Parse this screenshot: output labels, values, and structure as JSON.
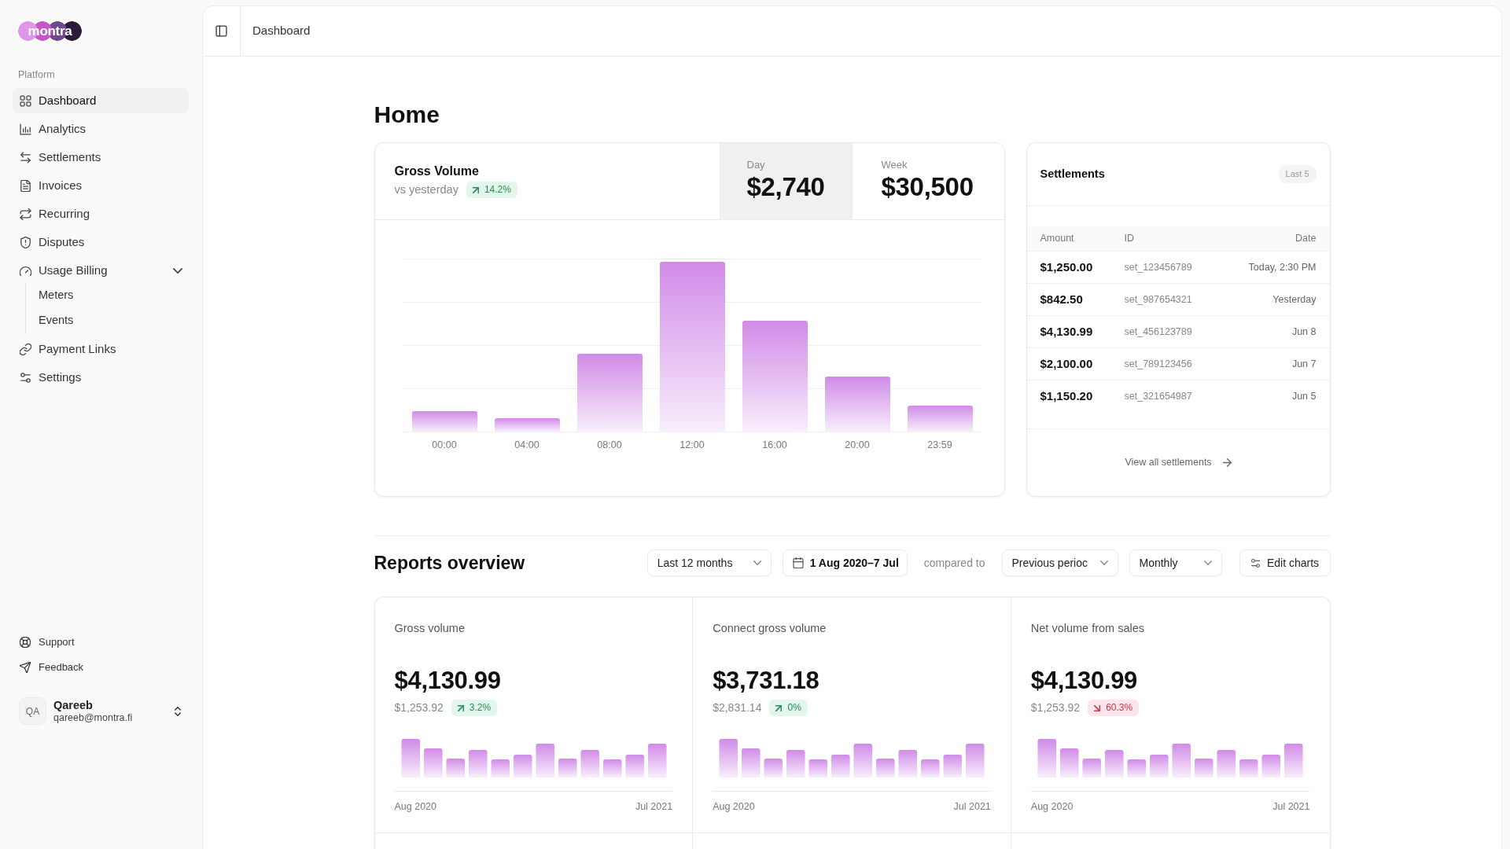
{
  "sidebar": {
    "logo": "montra",
    "section_label": "Platform",
    "items": [
      {
        "label": "Dashboard",
        "selected": true
      },
      {
        "label": "Analytics",
        "selected": false
      },
      {
        "label": "Settlements",
        "selected": false
      },
      {
        "label": "Invoices",
        "selected": false
      },
      {
        "label": "Recurring",
        "selected": false
      },
      {
        "label": "Disputes",
        "selected": false
      },
      {
        "label": "Usage Billing",
        "selected": false,
        "expanded": true,
        "children": [
          {
            "label": "Meters",
            "selected": false
          },
          {
            "label": "Events",
            "selected": false
          }
        ]
      },
      {
        "label": "Payment Links",
        "selected": false
      },
      {
        "label": "Settings",
        "selected": false
      }
    ],
    "footer_items": [
      {
        "label": "Support"
      },
      {
        "label": "Feedback"
      }
    ],
    "user": {
      "initials": "QA",
      "name": "Qareeb",
      "email": "qareeb@montra.fi"
    }
  },
  "header": {
    "breadcrumb": "Dashboard"
  },
  "page_title": "Home",
  "gross_volume": {
    "title": "Gross Volume",
    "subtitle": "vs yesterday",
    "change": {
      "value": "14.2%",
      "kind": "up"
    },
    "stats": [
      {
        "label": "Day",
        "value": "$2,740",
        "selected": true
      },
      {
        "label": "Week",
        "value": "$30,500",
        "selected": false
      }
    ],
    "axis_labels": [
      "00:00",
      "04:00",
      "08:00",
      "12:00",
      "16:00",
      "20:00",
      "23:59"
    ]
  },
  "settlements": {
    "title": "Settlements",
    "badge": "Last 5",
    "columns": [
      "Amount",
      "ID",
      "Date"
    ],
    "rows": [
      {
        "amount": "$1,250.00",
        "id": "set_123456789",
        "date": "Today, 2:30 PM"
      },
      {
        "amount": "$842.50",
        "id": "set_987654321",
        "date": "Yesterday"
      },
      {
        "amount": "$4,130.99",
        "id": "set_456123789",
        "date": "Jun 8"
      },
      {
        "amount": "$2,100.00",
        "id": "set_789123456",
        "date": "Jun 7"
      },
      {
        "amount": "$1,150.20",
        "id": "set_321654987",
        "date": "Jun 5"
      }
    ],
    "footer_link": "View all settlements"
  },
  "reports": {
    "title": "Reports overview",
    "filters": [
      {
        "kind": "dropdown",
        "label": "Last 12 months"
      },
      {
        "kind": "date",
        "label": "1 Aug 2020–7 Jul"
      },
      {
        "kind": "text",
        "label": "compared to"
      },
      {
        "kind": "dropdown",
        "label": "Previous perioc"
      },
      {
        "kind": "dropdown",
        "label": "Monthly"
      },
      {
        "kind": "button",
        "label": "Edit charts"
      }
    ],
    "cards": [
      {
        "title": "Gross volume",
        "value": "$4,130.99",
        "previous": "$1,253.92",
        "change": {
          "value": "3.2%",
          "kind": "up"
        },
        "axis_start": "Aug 2020",
        "axis_end": "Jul 2021"
      },
      {
        "title": "Connect gross volume",
        "value": "$3,731.18",
        "previous": "$2,831.14",
        "change": {
          "value": "0%",
          "kind": "up"
        },
        "axis_start": "Aug 2020",
        "axis_end": "Jul 2021"
      },
      {
        "title": "Net volume from sales",
        "value": "$4,130.99",
        "previous": "$1,253.92",
        "change": {
          "value": "60.3%",
          "kind": "down"
        },
        "axis_start": "Aug 2020",
        "axis_end": "Jul 2021"
      }
    ]
  }
}
